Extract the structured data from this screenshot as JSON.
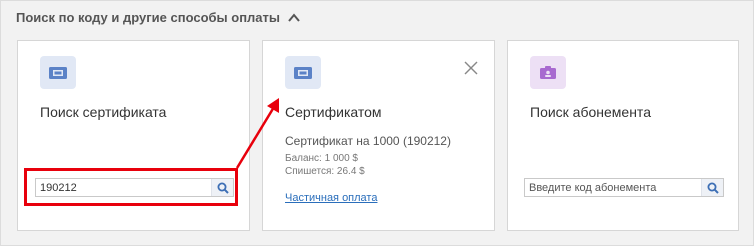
{
  "section": {
    "title": "Поиск по коду и другие способы оплаты",
    "icon": "chevron-up-icon"
  },
  "cards": {
    "certificate_search": {
      "title": "Поиск сертификата",
      "icon": "ticket-icon",
      "input_value": "190212",
      "button_icon": "search-icon"
    },
    "certificate": {
      "title": "Сертификатом",
      "icon": "ticket-icon",
      "close_icon": "close-icon",
      "name": "Сертификат на 1000 (190212)",
      "balance": "Баланс: 1 000 $",
      "charge": "Спишется: 26.4 $",
      "partial_payment_link": "Частичная оплата"
    },
    "subscription_search": {
      "title": "Поиск абонемента",
      "icon": "id-card-icon",
      "input_placeholder": "Введите код абонемента",
      "button_icon": "search-icon"
    }
  },
  "annotation": {
    "highlight_color": "#e8000c",
    "arrow": "arrow-icon"
  },
  "colors": {
    "link": "#2a6ebb",
    "icon_blue_bg": "#e1e8f5",
    "icon_purple_bg": "#ede0f5"
  }
}
